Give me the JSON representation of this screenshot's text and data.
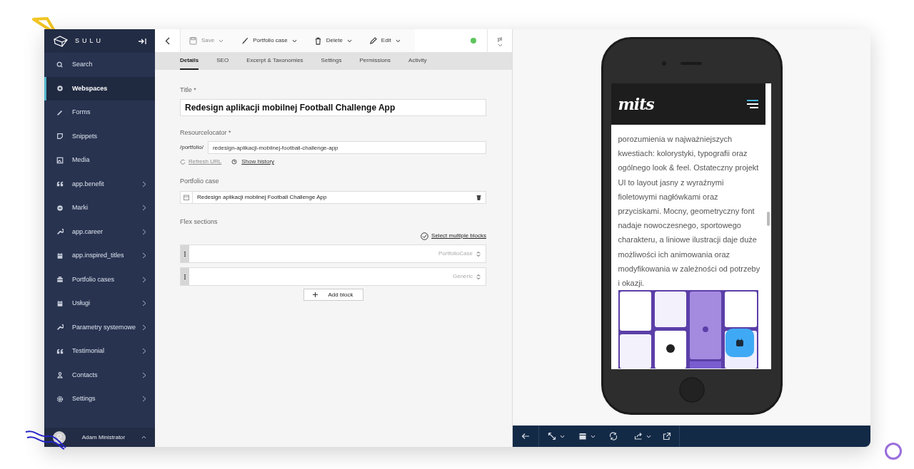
{
  "sidebar": {
    "brand": "SULU",
    "items": [
      {
        "label": "Search",
        "selected": false,
        "expandable": false
      },
      {
        "label": "Webspaces",
        "selected": true,
        "expandable": false
      },
      {
        "label": "Forms",
        "selected": false,
        "expandable": false
      },
      {
        "label": "Snippets",
        "selected": false,
        "expandable": false
      },
      {
        "label": "Media",
        "selected": false,
        "expandable": false
      },
      {
        "label": "app.benefit",
        "selected": false,
        "expandable": true
      },
      {
        "label": "Marki",
        "selected": false,
        "expandable": true
      },
      {
        "label": "app.career",
        "selected": false,
        "expandable": true
      },
      {
        "label": "app.inspired_titles",
        "selected": false,
        "expandable": true
      },
      {
        "label": "Portfolio cases",
        "selected": false,
        "expandable": true
      },
      {
        "label": "Usługi",
        "selected": false,
        "expandable": true
      },
      {
        "label": "Parametry systemowe",
        "selected": false,
        "expandable": true
      },
      {
        "label": "Testimonial",
        "selected": false,
        "expandable": true
      },
      {
        "label": "Contacts",
        "selected": false,
        "expandable": true
      },
      {
        "label": "Settings",
        "selected": false,
        "expandable": true
      }
    ],
    "user": {
      "name": "Adam Ministrator"
    }
  },
  "toolbar": {
    "buttons": [
      {
        "label": "Save",
        "disabled": true
      },
      {
        "label": "Portfolio case",
        "disabled": false
      },
      {
        "label": "Delete",
        "disabled": false
      },
      {
        "label": "Edit",
        "disabled": false
      }
    ],
    "published": true,
    "locale": "pl"
  },
  "tabs": [
    {
      "label": "Details",
      "selected": true
    },
    {
      "label": "SEO",
      "selected": false
    },
    {
      "label": "Excerpt & Taxonomies",
      "selected": false
    },
    {
      "label": "Settings",
      "selected": false
    },
    {
      "label": "Permissions",
      "selected": false
    },
    {
      "label": "Activity",
      "selected": false
    }
  ],
  "form": {
    "title_label": "Title *",
    "title_value": "Redesign aplikacji mobilnej Football Challenge App",
    "url_label": "Resourcelocator *",
    "url_prefix": "/portfolio/",
    "url_value": "redesign-aplikacji-mobilnej-football-challenge-app",
    "refresh_url": {
      "label": "Refresh URL",
      "disabled": true
    },
    "show_history": "Show history",
    "portfolio_label": "Portfolio case",
    "portfolio_value": "Redesign aplikacji mobilnej Football Challenge App",
    "flex_label": "Flex sections",
    "select_multiple": "Select multiple blocks",
    "blocks": [
      {
        "type": "PortfolioCase"
      },
      {
        "type": "Generic"
      }
    ],
    "add_block": "Add block"
  },
  "preview": {
    "logo": "mits",
    "paragraph": "porozumienia w najważniejszych kwestiach: kolorystyki, typografii oraz ogólnego look & feel. Ostateczny projekt UI to layout jasny z wyraźnymi fioletowymi nagłówkami oraz przyciskami. Mocny, geometryczny font nadaje nowoczesnego, sportowego charakteru, a liniowe ilustracji daje duże możliwości ich animowania oraz modyfikowania w zależności od potrzeby i okazji."
  }
}
